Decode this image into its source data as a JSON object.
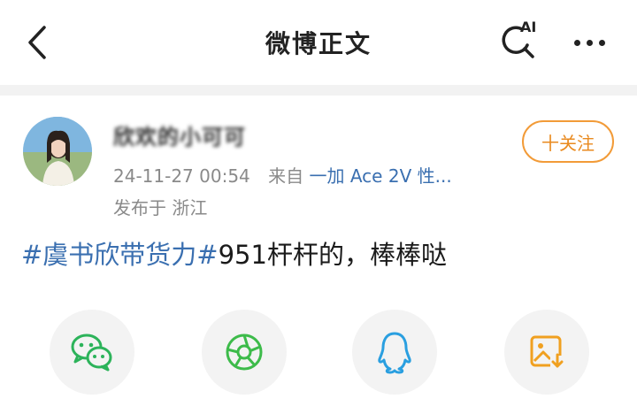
{
  "header": {
    "title": "微博正文",
    "ai_label": "AI"
  },
  "post": {
    "author": {
      "name": "欣欢的小可可"
    },
    "timestamp": "24-11-27 00:54",
    "source_prefix": "来自",
    "device": "一加 Ace 2V 性...",
    "location": "发布于 浙江",
    "follow_label": "十关注",
    "topic": "#虞书欣带货力#",
    "text": "951杆杆的，棒棒哒"
  },
  "share": {
    "items": [
      {
        "icon": "wechat-icon",
        "color": "#2cb35a"
      },
      {
        "icon": "moments-icon",
        "color": "#3dbb4a"
      },
      {
        "icon": "qq-icon",
        "color": "#2a9fe0"
      },
      {
        "icon": "save-image-icon",
        "color": "#f0a020"
      }
    ]
  }
}
